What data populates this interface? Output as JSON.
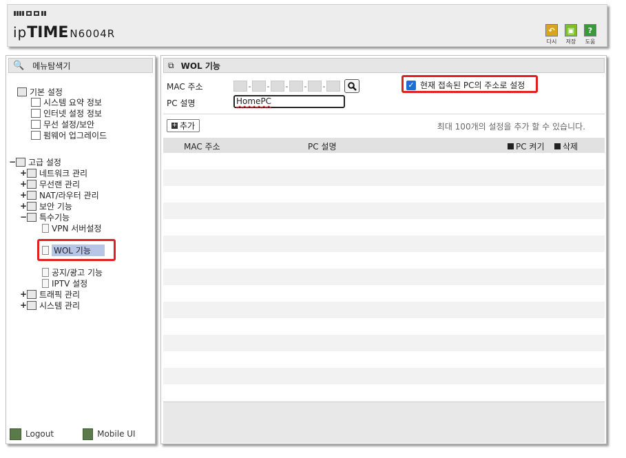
{
  "header": {
    "brand_ip": "ip",
    "brand_time": "TIME",
    "model": "N6004R",
    "buttons": [
      {
        "label": "다시",
        "icon": "undo-icon",
        "color": "#d9a521"
      },
      {
        "label": "저장",
        "icon": "save-icon",
        "color": "#7bbf2a"
      },
      {
        "label": "도움",
        "icon": "help-icon",
        "color": "#3a9a3a"
      }
    ]
  },
  "sidebar": {
    "title": "메뉴탐색기",
    "basic": {
      "label": "기본 설정",
      "items": [
        "시스템 요약 정보",
        "인터넷 설정 정보",
        "무선 설정/보안",
        "펌웨어 업그레이드"
      ]
    },
    "advanced": {
      "label": "고급 설정",
      "items": [
        "네트워크 관리",
        "무선랜 관리",
        "NAT/라우터 관리",
        "보안 기능",
        "특수기능",
        "트래픽 관리",
        "시스템 관리"
      ],
      "special_items": [
        "VPN 서버설정",
        "WOL 기능",
        "공지/광고 기능",
        "IPTV 설정"
      ]
    },
    "logout": "Logout",
    "mobile": "Mobile UI"
  },
  "main": {
    "title": "WOL 기능",
    "mac_label": "MAC 주소",
    "pc_label": "PC 설명",
    "pc_value": "HomePC",
    "checkbox_label": "현재 접속된 PC의 주소로 설정",
    "checkbox_checked": true,
    "add_button": "추가",
    "limit_text": "최대 100개의 설정을 추가 할 수 있습니다.",
    "columns": {
      "mac": "MAC 주소",
      "pc": "PC 설명",
      "wake": "PC 켜기",
      "delete": "삭제"
    }
  },
  "colors": {
    "highlight": "#b7c6e6",
    "annotation_red": "#e01f1f",
    "checkbox_blue": "#1a6fd6"
  }
}
